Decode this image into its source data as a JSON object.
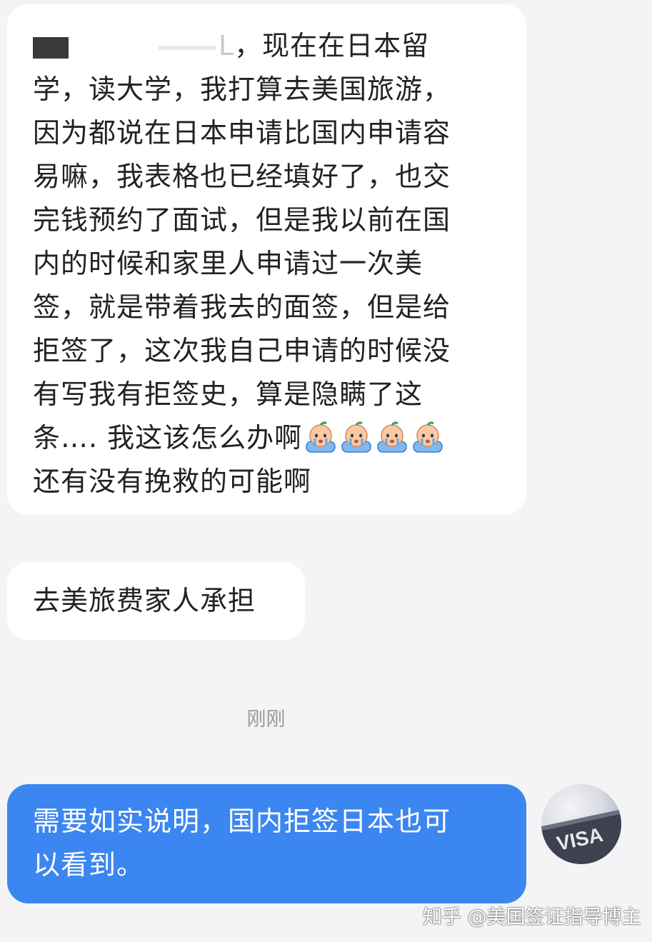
{
  "messages": [
    {
      "sender": "other",
      "lines": [
        "，现在在日本留",
        "学，读大学，我打算去美国旅游，",
        "因为都说在日本申请比国内申请容",
        "易嘛，我表格也已经填好了，也交",
        "完钱预约了面试，但是我以前在国",
        "内的时候和家里人申请过一次美",
        "签，就是带着我去的面签，但是给",
        "拒签了，这次我自己申请的时候没",
        "有写我有拒签史，算是隐瞒了这",
        "条…. 我这该怎么办啊",
        "还有没有挽救的可能啊"
      ],
      "blur_char": "L"
    },
    {
      "sender": "other",
      "text": "去美旅费家人承担"
    },
    {
      "sender": "self",
      "lines": [
        "需要如实说明，国内拒签日本也可",
        "以看到。"
      ]
    }
  ],
  "timestamp": "刚刚",
  "avatar": {
    "label": "VISA"
  },
  "watermark": "知乎 @美国签证指导博主",
  "emoji": {
    "name": "crying-emoji",
    "count": 4
  },
  "colors": {
    "background": "#f4f4f6",
    "other_bubble": "#ffffff",
    "self_bubble": "#3b86f0",
    "text": "#222222",
    "timestamp": "#999999"
  }
}
